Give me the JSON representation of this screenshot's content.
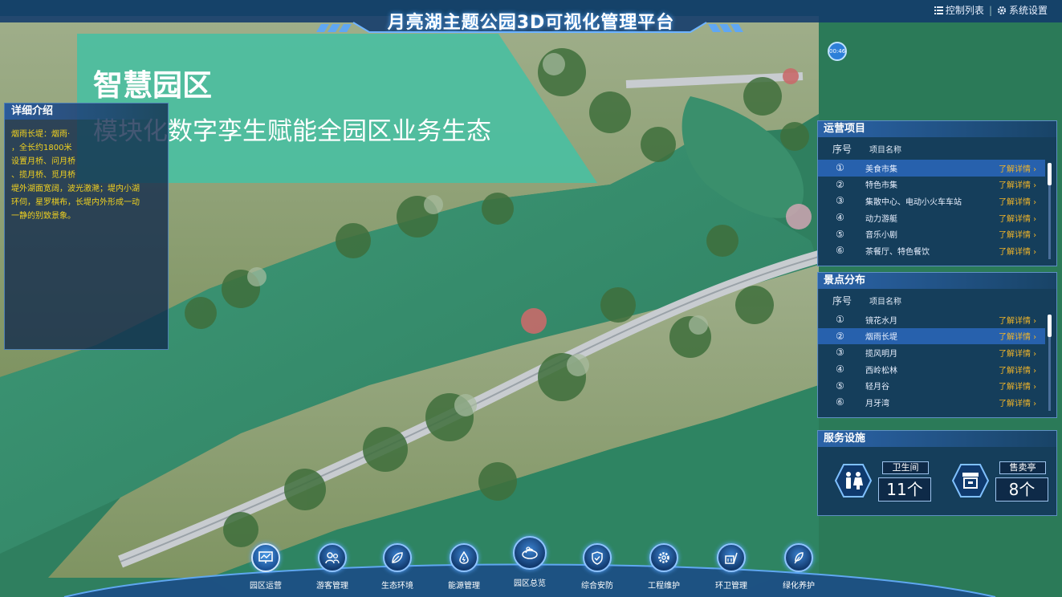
{
  "app": {
    "title": "月亮湖主题公园3D可视化管理平台",
    "actions": [
      {
        "icon": "list-icon",
        "label": "控制列表"
      },
      {
        "icon": "gear-icon",
        "label": "系统设置"
      }
    ],
    "clock": "00:46"
  },
  "banner": {
    "title": "智慧园区",
    "subtitle": "模块化数字孪生赋能全园区业务生态",
    "color": "#4bbea0"
  },
  "detail": {
    "title": "详细介绍",
    "lines": [
      "烟雨长堤：烟雨·",
      "，全长约1800米",
      "设置月桥、问月桥",
      "、揽月桥、觅月桥",
      "堤外湖面宽阔，波光激滟；堤内小湖",
      "环伺，星罗棋布，长堤内外形成一动",
      "一静的别致景象。"
    ]
  },
  "operations": {
    "title": "运营项目",
    "col_no": "序号",
    "col_name": "项目名称",
    "rows": [
      {
        "no": "①",
        "name": "美食市集",
        "detail": "了解详情 ›"
      },
      {
        "no": "②",
        "name": "特色市集",
        "detail": "了解详情 ›"
      },
      {
        "no": "③",
        "name": "集散中心、电动小火车车站",
        "detail": "了解详情 ›"
      },
      {
        "no": "④",
        "name": "动力游艇",
        "detail": "了解详情 ›"
      },
      {
        "no": "⑤",
        "name": "音乐小剧",
        "detail": "了解详情 ›"
      },
      {
        "no": "⑥",
        "name": "茶餐厅、特色餐饮",
        "detail": "了解详情 ›"
      }
    ]
  },
  "scenic": {
    "title": "景点分布",
    "col_no": "序号",
    "col_name": "项目名称",
    "rows": [
      {
        "no": "①",
        "name": "镜花水月",
        "detail": "了解详情 ›"
      },
      {
        "no": "②",
        "name": "烟雨长堤",
        "detail": "了解详情 ›"
      },
      {
        "no": "③",
        "name": "揽风明月",
        "detail": "了解详情 ›"
      },
      {
        "no": "④",
        "name": "西岭松林",
        "detail": "了解详情 ›"
      },
      {
        "no": "⑤",
        "name": "轻月谷",
        "detail": "了解详情 ›"
      },
      {
        "no": "⑥",
        "name": "月牙湾",
        "detail": "了解详情 ›"
      }
    ]
  },
  "services": {
    "title": "服务设施",
    "items": [
      {
        "icon": "restroom-icon",
        "label": "卫生间",
        "value": "11个"
      },
      {
        "icon": "kiosk-icon",
        "label": "售卖亭",
        "value": "8个"
      }
    ]
  },
  "nav": [
    {
      "icon": "chart-screen-icon",
      "label": "园区运营"
    },
    {
      "icon": "visitors-icon",
      "label": "游客管理"
    },
    {
      "icon": "leaf-icon",
      "label": "生态环境"
    },
    {
      "icon": "water-drop-icon",
      "label": "能源管理"
    },
    {
      "icon": "park-overview-icon",
      "label": "园区总览"
    },
    {
      "icon": "shield-icon",
      "label": "综合安防"
    },
    {
      "icon": "gear-icon",
      "label": "工程维护"
    },
    {
      "icon": "sanitation-icon",
      "label": "环卫管理"
    },
    {
      "icon": "plant-icon",
      "label": "绿化养护"
    }
  ]
}
